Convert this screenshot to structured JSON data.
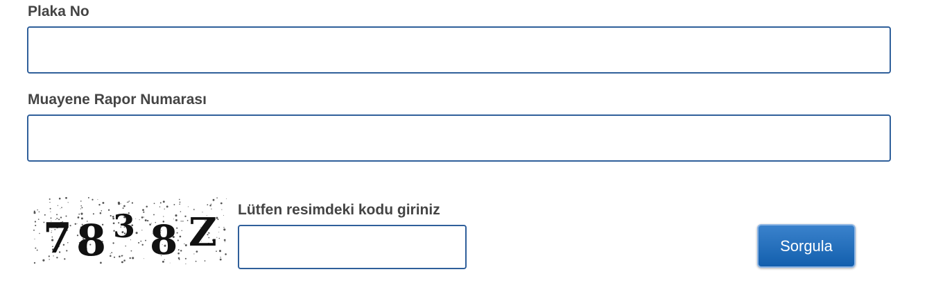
{
  "form": {
    "plate": {
      "label": "Plaka No",
      "value": ""
    },
    "report": {
      "label": "Muayene Rapor Numarası",
      "value": ""
    },
    "captcha": {
      "image_text": "7838Z",
      "label": "Lütfen resimdeki kodu giriniz",
      "value": ""
    },
    "submit_label": "Sorgula"
  },
  "colors": {
    "input_border": "#2f5f9a",
    "button_top": "#3a82cc",
    "button_bottom": "#135fad"
  }
}
